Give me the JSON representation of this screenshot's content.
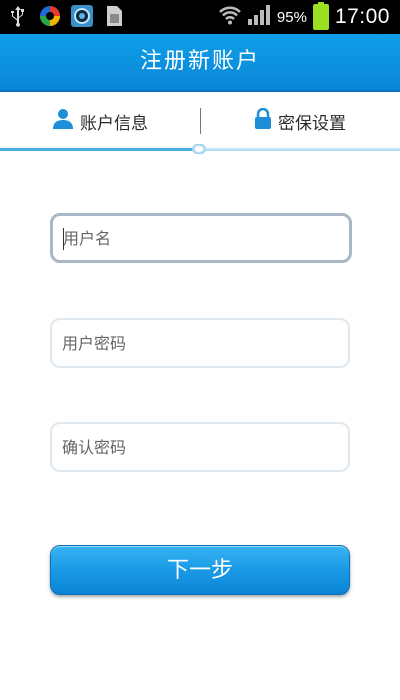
{
  "status_bar": {
    "battery_percent": "95%",
    "time": "17:00",
    "icons": [
      "usb-icon",
      "app-sync-icon",
      "camera-app-icon",
      "sim-card-icon",
      "wifi-icon",
      "signal-icon",
      "battery-charging-icon"
    ]
  },
  "header": {
    "title": "注册新账户"
  },
  "tabs": [
    {
      "label": "账户信息",
      "icon": "person-icon",
      "active": true
    },
    {
      "label": "密保设置",
      "icon": "lock-icon",
      "active": false
    }
  ],
  "step_progress": 0.5,
  "form": {
    "username": {
      "placeholder": "用户名",
      "value": ""
    },
    "password": {
      "placeholder": "用户密码",
      "value": ""
    },
    "confirm_password": {
      "placeholder": "确认密码",
      "value": ""
    }
  },
  "actions": {
    "next_label": "下一步"
  },
  "colors": {
    "primary": "#0a86d6",
    "field_border": "#dfe8ee",
    "focused_border": "#a9b8c4"
  }
}
